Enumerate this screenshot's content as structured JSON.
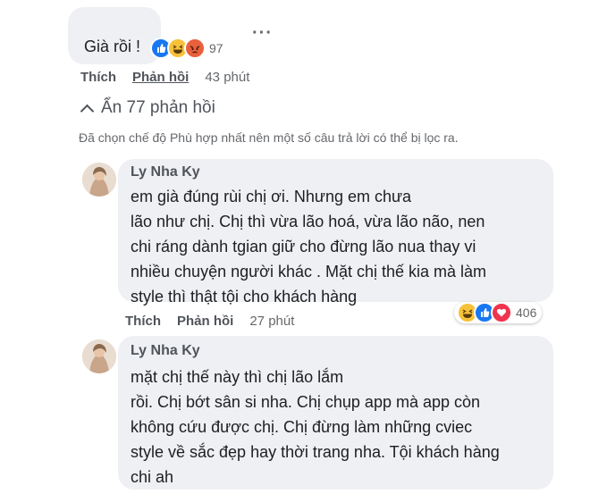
{
  "top_comment": {
    "text": "Già rồi !",
    "reactions": {
      "icons": [
        "like-icon",
        "haha-icon",
        "angry-icon"
      ],
      "count": "97"
    },
    "actions": {
      "like": "Thích",
      "reply": "Phản hồi",
      "time": "43 phút"
    }
  },
  "hide_replies": {
    "label": "Ẩn 77 phản hồi"
  },
  "filter_note": "Đã chọn chế độ Phù hợp nhất nên một số câu trả lời có thể bị lọc ra.",
  "replies": [
    {
      "author": "Ly Nha Ky",
      "text": "              em già đúng rùi chị ơi. Nhưng em chưa\nlão như chị. Chị thì vừa lão hoá, vừa lão não, nen\nchi ráng dành tgian giữ cho đừng lão nua thay vi\nnhiều chuyện người khác . Mặt chị thế kia mà làm\nstyle thì thật tội cho khách hàng",
      "actions": {
        "like": "Thích",
        "reply": "Phản hồi",
        "time": "27 phút"
      },
      "reactions": {
        "icons": [
          "haha-icon",
          "like-icon",
          "love-icon"
        ],
        "count": "406"
      }
    },
    {
      "author": "Ly Nha Ky",
      "text": "          mặt chị                thế này thì chị lão lắm\nrồi. Chị bớt sân si nha. Chị chụp app mà app còn\nkhông cứu được chị. Chị đừng làm những cviec\nstyle về sắc đẹp hay thời trang nha. Tội khách hàng\nchi ah"
    }
  ],
  "colors": {
    "bubble": "#eef0f3",
    "like": "#1877f2",
    "haha": "#f7c23a",
    "angry": "#e8603c",
    "love": "#f0334e"
  }
}
